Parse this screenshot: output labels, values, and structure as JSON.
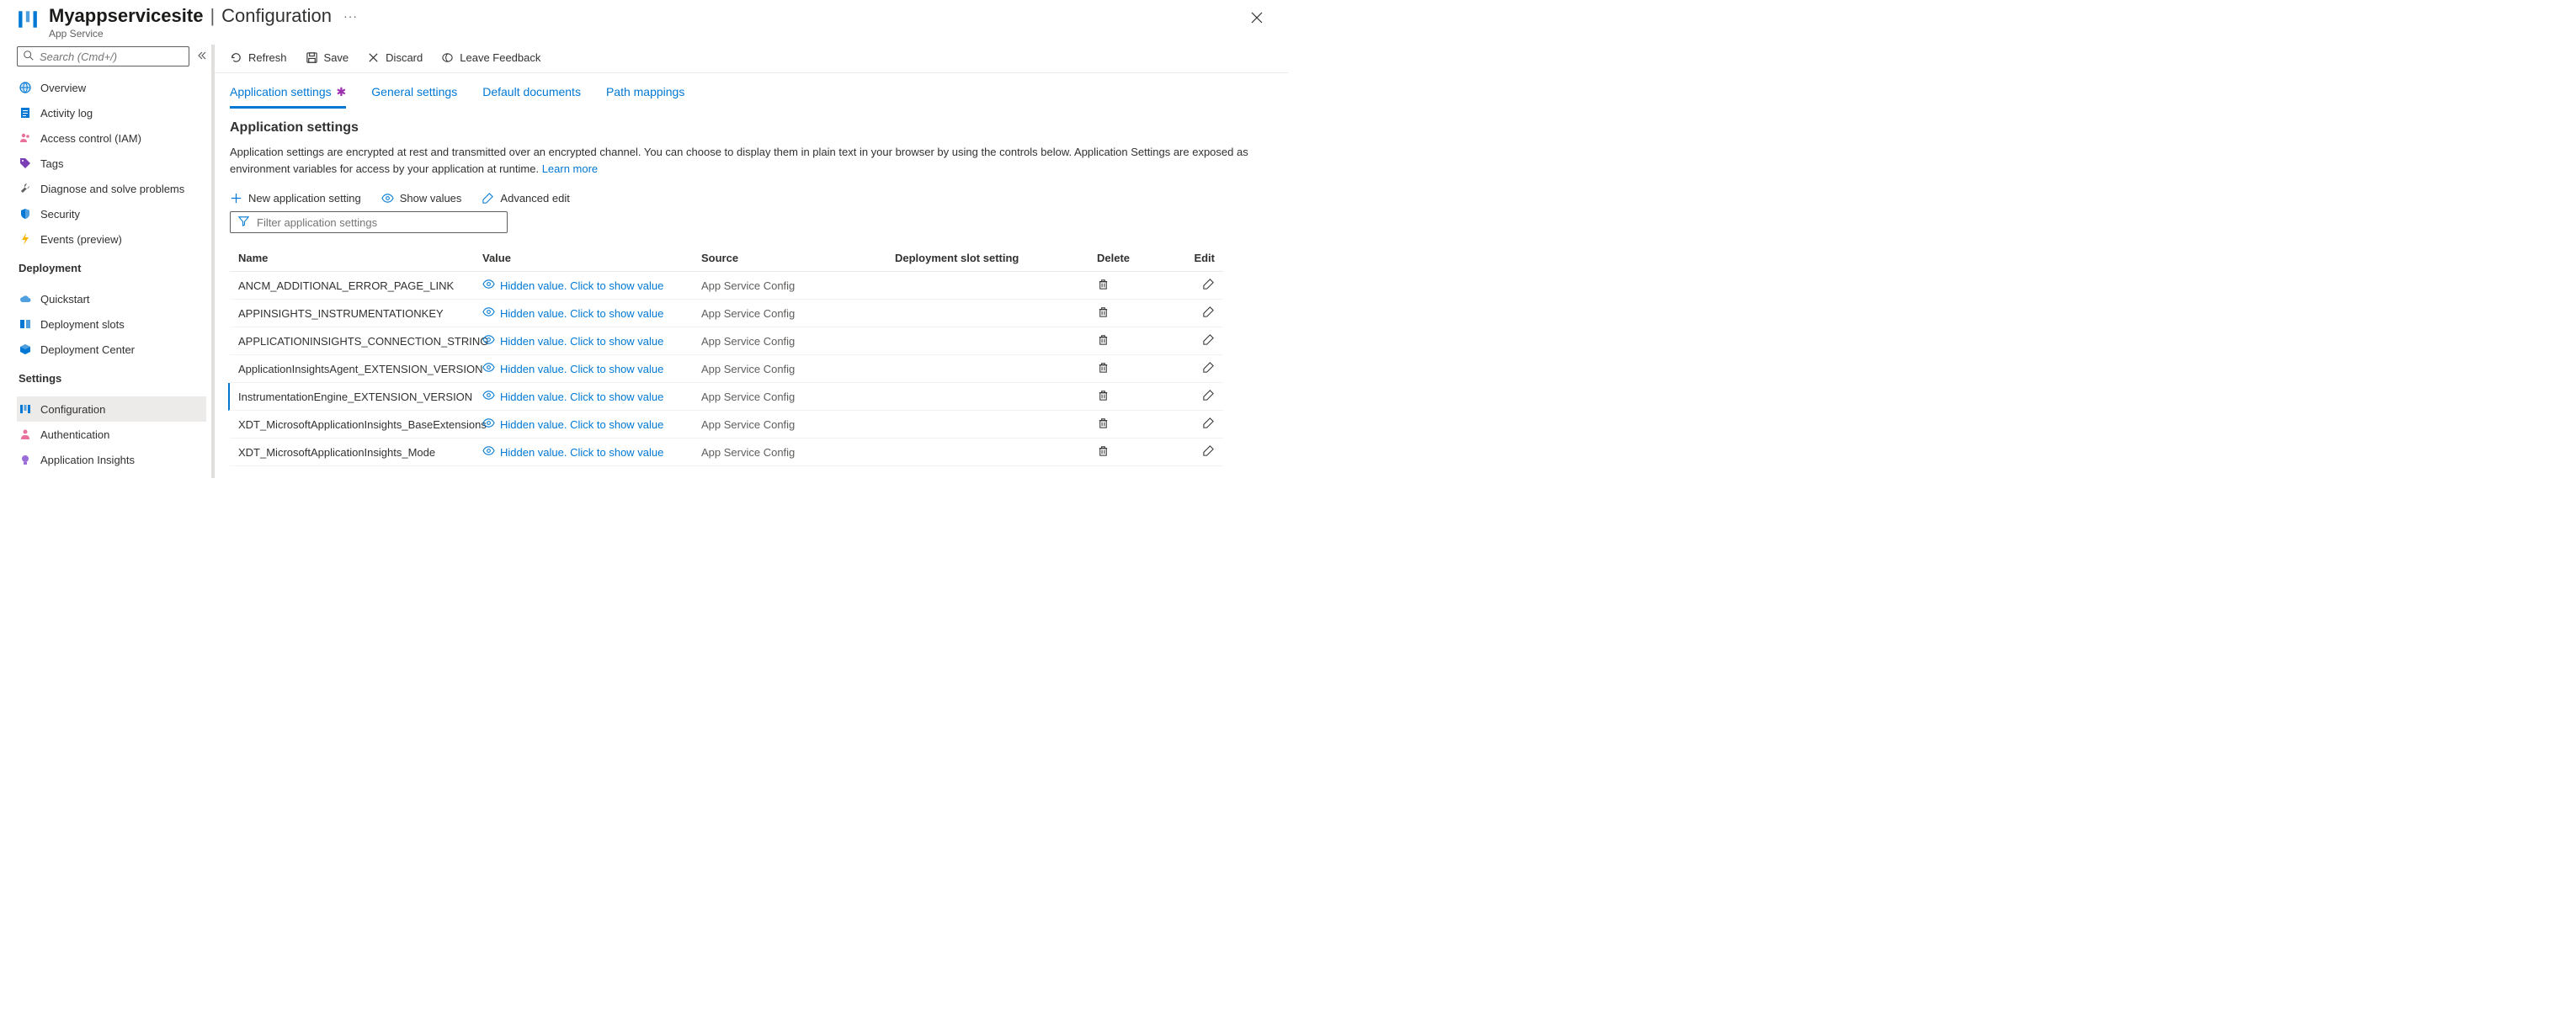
{
  "header": {
    "title_main": "Myappservicesite",
    "title_section": "Configuration",
    "subtitle": "App Service"
  },
  "search": {
    "placeholder": "Search (Cmd+/)"
  },
  "nav": {
    "items": [
      {
        "label": "Overview",
        "icon": "globe"
      },
      {
        "label": "Activity log",
        "icon": "log"
      },
      {
        "label": "Access control (IAM)",
        "icon": "people"
      },
      {
        "label": "Tags",
        "icon": "tag"
      },
      {
        "label": "Diagnose and solve problems",
        "icon": "wrench"
      },
      {
        "label": "Security",
        "icon": "shield"
      },
      {
        "label": "Events (preview)",
        "icon": "bolt"
      }
    ],
    "section_deployment": "Deployment",
    "deployment": [
      {
        "label": "Quickstart",
        "icon": "cloud"
      },
      {
        "label": "Deployment slots",
        "icon": "slots"
      },
      {
        "label": "Deployment Center",
        "icon": "package"
      }
    ],
    "section_settings": "Settings",
    "settings": [
      {
        "label": "Configuration",
        "icon": "bars",
        "active": true
      },
      {
        "label": "Authentication",
        "icon": "user"
      },
      {
        "label": "Application Insights",
        "icon": "bulb"
      }
    ]
  },
  "toolbar": {
    "refresh": "Refresh",
    "save": "Save",
    "discard": "Discard",
    "feedback": "Leave Feedback"
  },
  "tabs": [
    {
      "label": "Application settings",
      "active": true,
      "dirty": true
    },
    {
      "label": "General settings"
    },
    {
      "label": "Default documents"
    },
    {
      "label": "Path mappings"
    }
  ],
  "section": {
    "heading": "Application settings",
    "description": "Application settings are encrypted at rest and transmitted over an encrypted channel. You can choose to display them in plain text in your browser by using the controls below. Application Settings are exposed as environment variables for access by your application at runtime. ",
    "learn_more": "Learn more"
  },
  "sub_toolbar": {
    "new": "New application setting",
    "show_values": "Show values",
    "advanced_edit": "Advanced edit"
  },
  "filter": {
    "placeholder": "Filter application settings"
  },
  "table": {
    "columns": {
      "name": "Name",
      "value": "Value",
      "source": "Source",
      "slot": "Deployment slot setting",
      "delete": "Delete",
      "edit": "Edit"
    },
    "hidden_value_text": "Hidden value. Click to show value",
    "source_text": "App Service Config",
    "rows": [
      {
        "name": "ANCM_ADDITIONAL_ERROR_PAGE_LINK"
      },
      {
        "name": "APPINSIGHTS_INSTRUMENTATIONKEY"
      },
      {
        "name": "APPLICATIONINSIGHTS_CONNECTION_STRING"
      },
      {
        "name": "ApplicationInsightsAgent_EXTENSION_VERSION"
      },
      {
        "name": "InstrumentationEngine_EXTENSION_VERSION",
        "active": true
      },
      {
        "name": "XDT_MicrosoftApplicationInsights_BaseExtensions"
      },
      {
        "name": "XDT_MicrosoftApplicationInsights_Mode"
      }
    ]
  }
}
